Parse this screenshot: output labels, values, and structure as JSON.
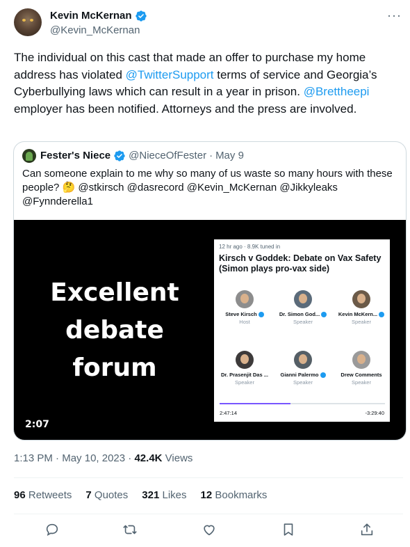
{
  "author": {
    "name": "Kevin McKernan",
    "handle": "@Kevin_McKernan",
    "verified": true
  },
  "menu_icon": "more-horizontal-icon",
  "tweet": {
    "text_1": "The individual on this cast that made an offer to purchase my home address has violated ",
    "mention_1": "@TwitterSupport",
    "text_2": " terms of service and Georgia’s Cyberbullying laws which can result in a year in prison. ",
    "mention_2": "@Brettheepi",
    "text_3": " employer has been notified. Attorneys and the press are involved."
  },
  "quote": {
    "name": "Fester's Niece",
    "handle": "@NieceOfFester",
    "separator": "·",
    "date": "May 9",
    "text": "Can someone explain to me why so many of us waste so many hours with these people? 🤔 @stkirsch @dasrecord @Kevin_McKernan @Jikkyleaks @Fynnderella1",
    "media": {
      "overlay_line1": "Excellent",
      "overlay_line2": "debate",
      "overlay_line3": "forum",
      "duration": "2:07",
      "card": {
        "meta": "12 hr ago · 8.9K tuned in",
        "title": "Kirsch v Goddek: Debate on Vax Safety (Simon plays pro-vax side)",
        "speakers": [
          {
            "name": "Steve Kirsch",
            "role": "Host",
            "verified": true
          },
          {
            "name": "Dr. Simon God...",
            "role": "Speaker",
            "verified": true
          },
          {
            "name": "Kevin McKern...",
            "role": "Speaker",
            "verified": true
          },
          {
            "name": "Dr. Prasenjit Das ...",
            "role": "Speaker",
            "verified": false
          },
          {
            "name": "Gianni Palermo",
            "role": "Speaker",
            "verified": true
          },
          {
            "name": "Drew Comments",
            "role": "Speaker",
            "verified": false
          }
        ],
        "progress": 0.43,
        "time_elapsed": "2:47:14",
        "time_remaining": "-3:29:40"
      }
    }
  },
  "meta": {
    "time": "1:13 PM",
    "separator": "·",
    "date": "May 10, 2023",
    "views_count": "42.4K",
    "views_label": "Views"
  },
  "stats": {
    "retweets_count": "96",
    "retweets_label": "Retweets",
    "quotes_count": "7",
    "quotes_label": "Quotes",
    "likes_count": "321",
    "likes_label": "Likes",
    "bookmarks_count": "12",
    "bookmarks_label": "Bookmarks"
  },
  "colors": {
    "link": "#1d9bf0",
    "muted": "#536471",
    "text": "#0f1419",
    "progress_fill": "#7856ff"
  },
  "action_icons": [
    "reply-icon",
    "retweet-icon",
    "like-icon",
    "bookmark-icon",
    "share-icon"
  ]
}
